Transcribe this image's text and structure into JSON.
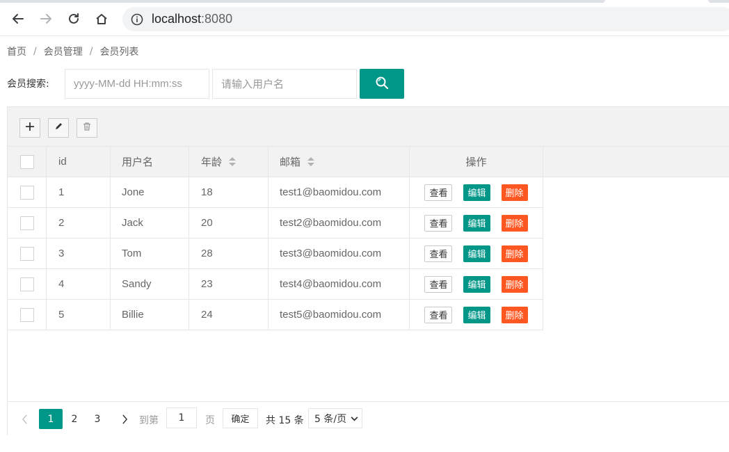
{
  "browser": {
    "url_host": "localhost",
    "url_port": ":8080"
  },
  "breadcrumb": {
    "items": [
      "首页",
      "会员管理",
      "会员列表"
    ],
    "separator": "/"
  },
  "search": {
    "label": "会员搜索:",
    "date_placeholder": "yyyy-MM-dd HH:mm:ss",
    "name_placeholder": "请输入用户名"
  },
  "toolbar": {
    "buttons": [
      "add-icon",
      "edit-icon",
      "delete-icon"
    ]
  },
  "table": {
    "headers": {
      "id": "id",
      "username": "用户名",
      "age": "年龄",
      "email": "邮箱",
      "actions": "操作"
    },
    "rows": [
      {
        "id": "1",
        "username": "Jone",
        "age": "18",
        "email": "test1@baomidou.com"
      },
      {
        "id": "2",
        "username": "Jack",
        "age": "20",
        "email": "test2@baomidou.com"
      },
      {
        "id": "3",
        "username": "Tom",
        "age": "28",
        "email": "test3@baomidou.com"
      },
      {
        "id": "4",
        "username": "Sandy",
        "age": "23",
        "email": "test4@baomidou.com"
      },
      {
        "id": "5",
        "username": "Billie",
        "age": "24",
        "email": "test5@baomidou.com"
      }
    ],
    "action_labels": {
      "view": "查看",
      "edit": "编辑",
      "delete": "删除"
    }
  },
  "pagination": {
    "pages": [
      "1",
      "2",
      "3"
    ],
    "current": "1",
    "goto_prefix": "到第",
    "goto_value": "1",
    "goto_suffix": "页",
    "confirm": "确定",
    "total": "共 15 条",
    "page_size": "5 条/页"
  },
  "colors": {
    "primary": "#009688",
    "danger": "#ff5722"
  }
}
